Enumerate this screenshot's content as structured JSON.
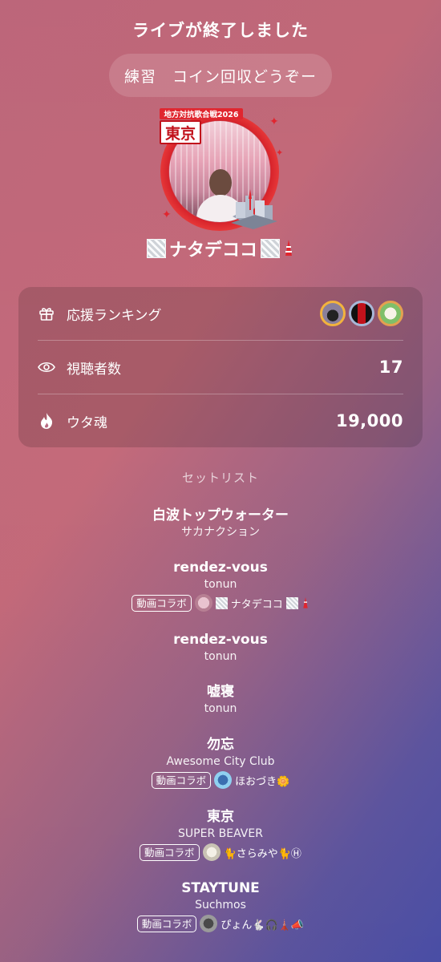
{
  "header": {
    "title": "ライブが終了しました"
  },
  "live": {
    "name": "練習　コイン回収どうぞー"
  },
  "avatar": {
    "event_badge": "地方対抗歌合戦2026",
    "city_badge": "東京"
  },
  "user": {
    "name": "ナタデココ"
  },
  "stats": {
    "support_ranking": {
      "label": "応援ランキング",
      "icon": "gift-icon"
    },
    "viewers": {
      "label": "視聴者数",
      "value": "17",
      "icon": "eye-icon"
    },
    "uta_soul": {
      "label": "ウタ魂",
      "value": "19,000",
      "icon": "flame-icon"
    }
  },
  "setlist": {
    "title": "セットリスト",
    "songs": [
      {
        "title": "白波トップウォーター",
        "artist": "サカナクション"
      },
      {
        "title": "rendez-vous",
        "artist": "tonun",
        "collab_label": "動画コラボ",
        "collab_user": "ナタデココ"
      },
      {
        "title": "rendez-vous",
        "artist": "tonun"
      },
      {
        "title": "嘘寝",
        "artist": "tonun"
      },
      {
        "title": "勿忘",
        "artist": "Awesome City Club",
        "collab_label": "動画コラボ",
        "collab_user": "ほおづき🌼"
      },
      {
        "title": "東京",
        "artist": "SUPER BEAVER",
        "collab_label": "動画コラボ",
        "collab_user": "🐈さらみや🐈Ⓗ"
      },
      {
        "title": "STAYTUNE",
        "artist": "Suchmos",
        "collab_label": "動画コラボ",
        "collab_user": "ぴょん🐇🎧🗼📣"
      }
    ]
  },
  "colors": {
    "badge_red": "#e0262f",
    "gold_ring": "#f2b33d"
  }
}
